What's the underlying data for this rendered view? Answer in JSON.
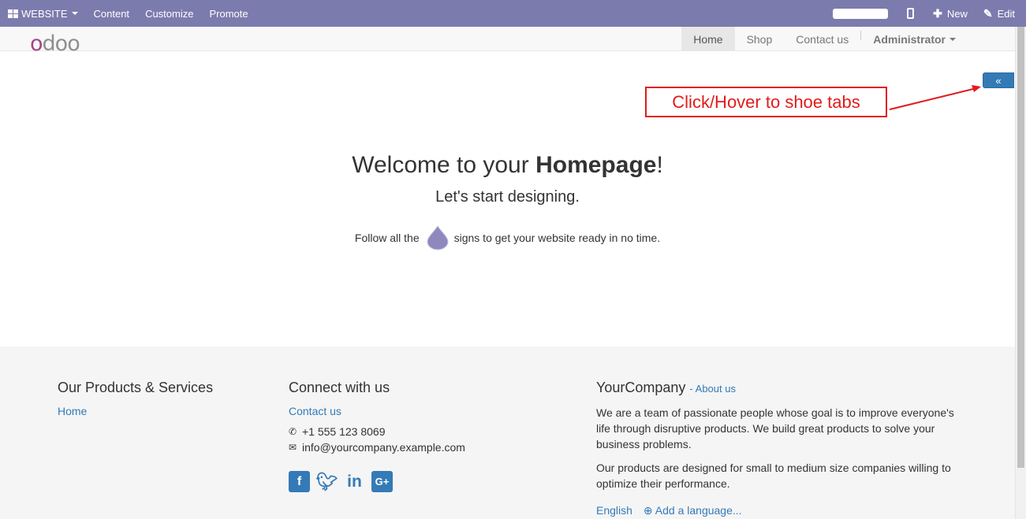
{
  "topbar": {
    "website_label": "WEBSITE",
    "content_label": "Content",
    "customize_label": "Customize",
    "promote_label": "Promote",
    "new_label": "New",
    "edit_label": "Edit"
  },
  "header": {
    "logo_first": "o",
    "logo_rest": "doo",
    "nav": [
      "Home",
      "Shop",
      "Contact us"
    ],
    "admin_label": "Administrator"
  },
  "toggle": {
    "label": "«"
  },
  "annotation": {
    "text": "Click/Hover to shoe tabs"
  },
  "hero": {
    "title_pre": "Welcome to your ",
    "title_bold": "Homepage",
    "title_post": "!",
    "subtitle": "Let's start designing.",
    "follow_pre": "Follow all the",
    "follow_post": "signs to get your website ready in no time."
  },
  "footer": {
    "col1": {
      "title": "Our Products & Services",
      "link": "Home"
    },
    "col2": {
      "title": "Connect with us",
      "link": "Contact us",
      "phone": "+1 555 123 8069",
      "email": "info@yourcompany.example.com"
    },
    "col3": {
      "title": "YourCompany",
      "about_link": "- About us",
      "p1": "We are a team of passionate people whose goal is to improve everyone's life through disruptive products. We build great products to solve your business problems.",
      "p2": "Our products are designed for small to medium size companies willing to optimize their performance.",
      "lang_english": "English",
      "lang_add": "Add a language..."
    }
  },
  "colors": {
    "topbar": "#7c7bad",
    "link": "#337ab7",
    "annotation": "#e21b1b"
  }
}
